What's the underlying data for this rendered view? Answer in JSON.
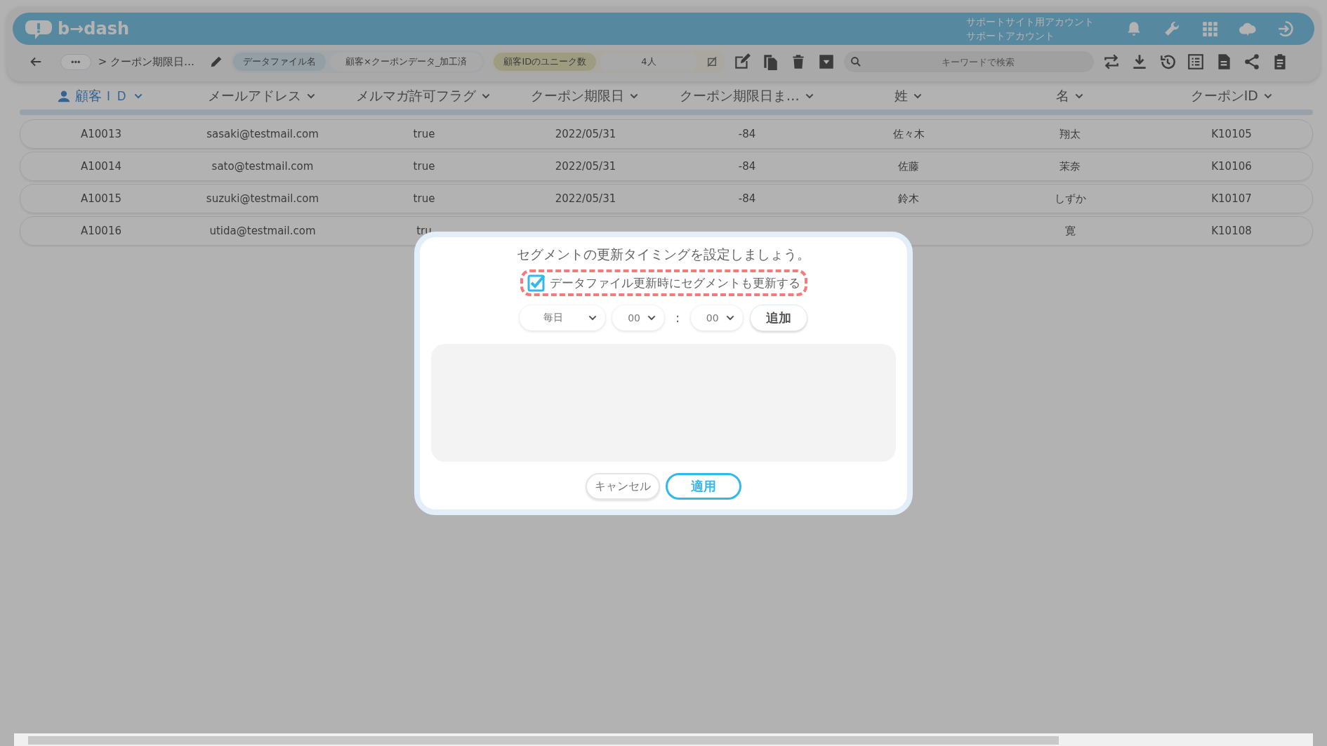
{
  "header": {
    "logo": "b→dash",
    "account_lines": [
      "サポートサイト用アカウント",
      "サポートアカウント"
    ]
  },
  "toolbar": {
    "more": "•••",
    "breadcrumb": "> クーポン期限日…",
    "file_label": "データファイル名",
    "file_value": "顧客×クーポンデータ_加工済",
    "metric_label": "顧客IDのユニーク数",
    "metric_value": "4人",
    "search": {
      "placeholder": "キーワードで検索"
    }
  },
  "table": {
    "columns": [
      {
        "label": "顧客ＩＤ",
        "key": true
      },
      {
        "label": "メールアドレス",
        "key": false
      },
      {
        "label": "メルマガ許可フラグ",
        "key": false
      },
      {
        "label": "クーポン期限日",
        "key": false
      },
      {
        "label": "クーポン期限日ま…",
        "key": false
      },
      {
        "label": "姓",
        "key": false
      },
      {
        "label": "名",
        "key": false
      },
      {
        "label": "クーポンID",
        "key": false
      }
    ],
    "rows": [
      [
        "A10013",
        "sasaki@testmail.com",
        "true",
        "2022/05/31",
        "-84",
        "佐々木",
        "翔太",
        "K10105"
      ],
      [
        "A10014",
        "sato@testmail.com",
        "true",
        "2022/05/31",
        "-84",
        "佐藤",
        "茉奈",
        "K10106"
      ],
      [
        "A10015",
        "suzuki@testmail.com",
        "true",
        "2022/05/31",
        "-84",
        "鈴木",
        "しずか",
        "K10107"
      ],
      [
        "A10016",
        "utida@testmail.com",
        "tru",
        null,
        null,
        null,
        "寛",
        "K10108"
      ]
    ]
  },
  "dialog": {
    "title": "セグメントの更新タイミングを設定しましょう。",
    "checkbox": {
      "label": "データファイル更新時にセグメントも更新する",
      "checked": true
    },
    "frequency": "毎日",
    "hour": "00",
    "separator": ":",
    "minute": "00",
    "add_button": "追加",
    "cancel_button": "キャンセル",
    "apply_button": "適用"
  }
}
